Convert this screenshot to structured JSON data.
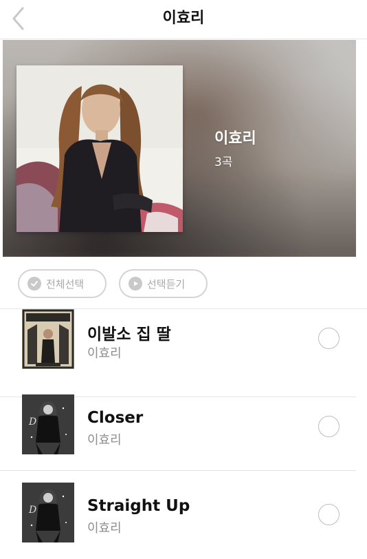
{
  "header": {
    "title": "이효리",
    "back_icon": "chevron-left-icon"
  },
  "hero": {
    "artist": "이효리",
    "track_count": "3곡"
  },
  "actions": {
    "select_all_label": "전체선택",
    "select_all_icon": "checkmark-circle-icon",
    "play_selected_label": "선택듣기",
    "play_selected_icon": "play-circle-icon"
  },
  "songs": [
    {
      "title": "이발소 집 딸",
      "artist": "이효리",
      "thumb_icon": "album-thumbnail"
    },
    {
      "title": "Closer",
      "artist": "이효리",
      "thumb_icon": "album-thumbnail"
    },
    {
      "title": "Straight Up",
      "artist": "이효리",
      "thumb_icon": "album-thumbnail"
    }
  ],
  "colors": {
    "accent_text": "#111111",
    "muted_text": "#8d8d8d",
    "pill_border": "#d4d4d4",
    "radio_border": "#bdbdbd"
  }
}
